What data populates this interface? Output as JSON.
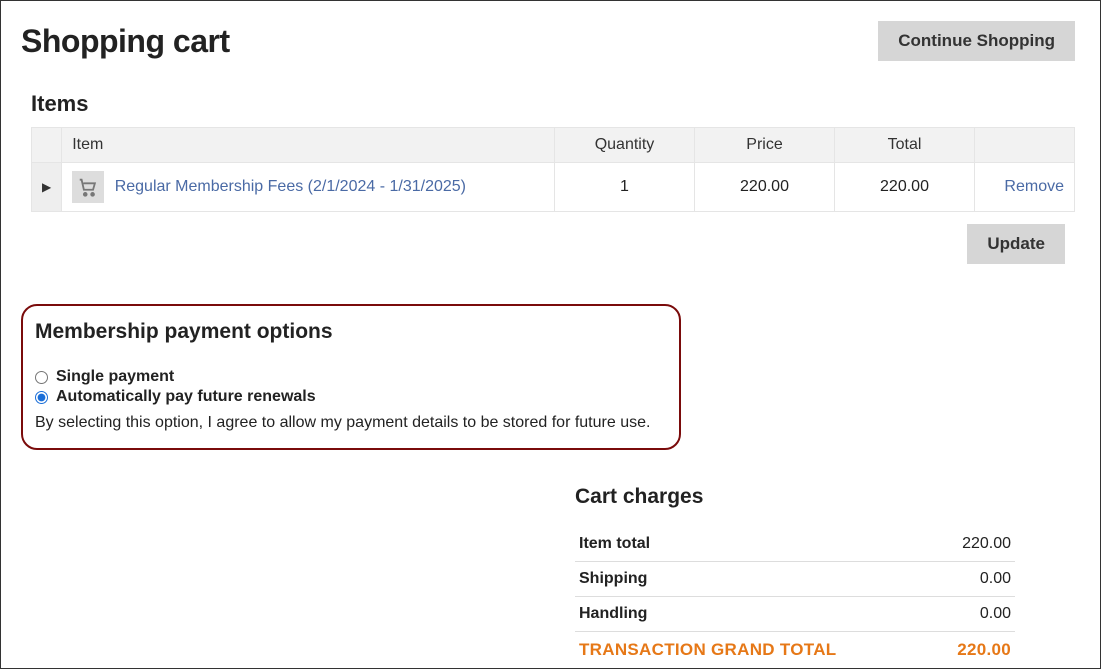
{
  "header": {
    "title": "Shopping cart",
    "continue_label": "Continue Shopping"
  },
  "items": {
    "section_title": "Items",
    "columns": {
      "item": "Item",
      "quantity": "Quantity",
      "price": "Price",
      "total": "Total"
    },
    "rows": [
      {
        "name": "Regular Membership Fees (2/1/2024 - 1/31/2025)",
        "quantity": "1",
        "price": "220.00",
        "total": "220.00",
        "remove_label": "Remove"
      }
    ],
    "update_label": "Update"
  },
  "payment_options": {
    "title": "Membership payment options",
    "single_label": "Single payment",
    "auto_label": "Automatically pay future renewals",
    "disclaimer": "By selecting this option, I agree to allow my payment details to be stored for future use."
  },
  "charges": {
    "title": "Cart charges",
    "rows": {
      "item_total_label": "Item total",
      "item_total_value": "220.00",
      "shipping_label": "Shipping",
      "shipping_value": "0.00",
      "handling_label": "Handling",
      "handling_value": "0.00",
      "grand_label": "TRANSACTION GRAND TOTAL",
      "grand_value": "220.00"
    }
  }
}
